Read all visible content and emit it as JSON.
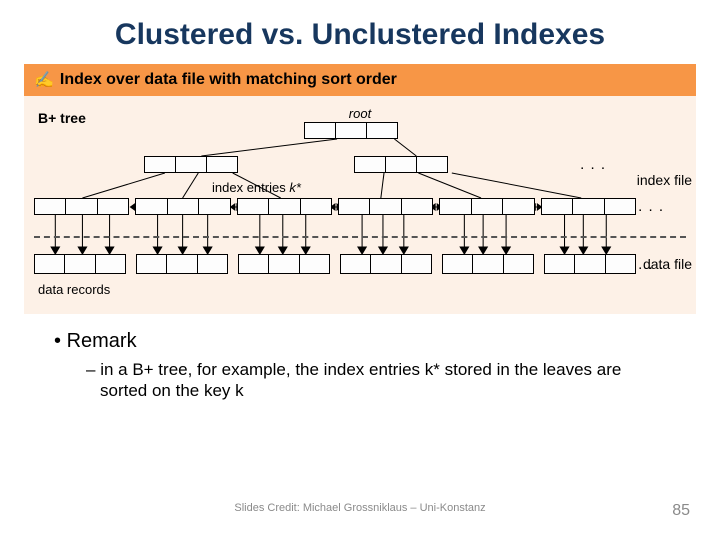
{
  "title": "Clustered vs. Unclustered Indexes",
  "banner": {
    "icon": "✍",
    "text": "Index over data file with matching sort order"
  },
  "diagram": {
    "bplus_label": "B+ tree",
    "root_label": "root",
    "index_entries_label": "index entries ",
    "index_entries_k": "k*",
    "dots": ". . .",
    "index_file_label": "index file",
    "data_file_label": "data file",
    "data_records_label": "data records"
  },
  "remark": {
    "heading": "Remark",
    "sub": "in a B+ tree, for example, the index entries k* stored in the leaves are sorted on the key k"
  },
  "footer": {
    "credit": "Slides Credit: Michael Grossniklaus – Uni-Konstanz",
    "page": "85"
  }
}
